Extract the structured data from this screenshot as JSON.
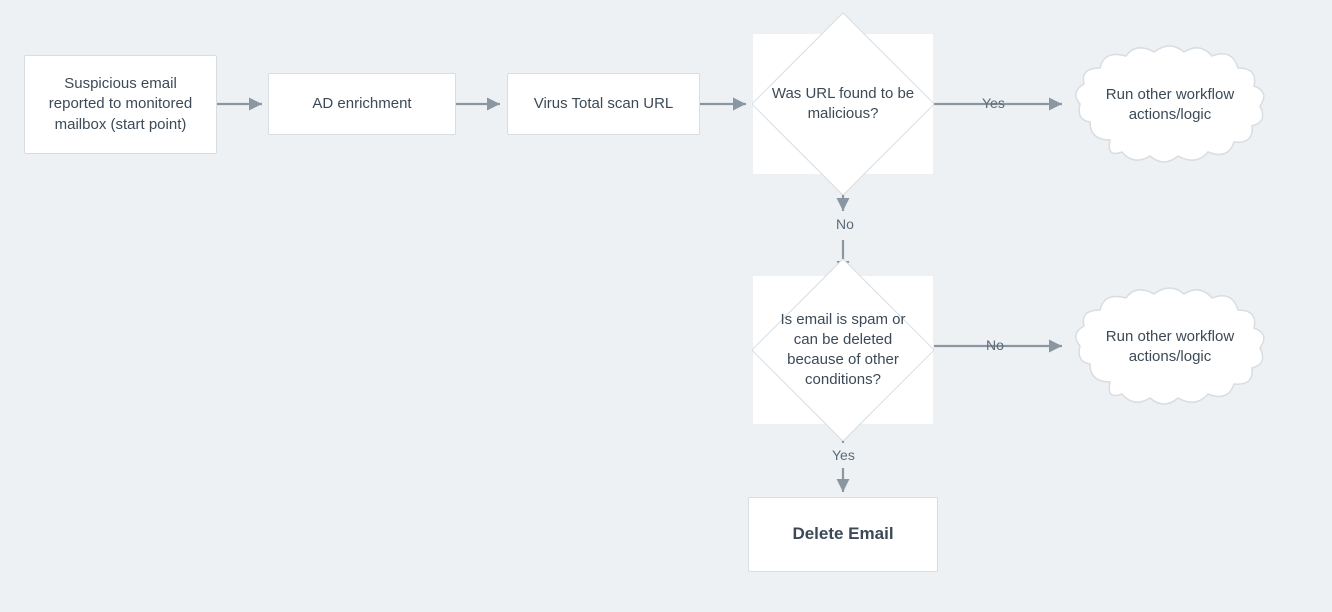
{
  "nodes": {
    "start": {
      "label": "Suspicious email reported to monitored mailbox (start point)"
    },
    "adEnrich": {
      "label": "AD enrichment"
    },
    "vtScan": {
      "label": "Virus Total scan URL"
    },
    "urlMalicious": {
      "label": "Was URL found to be malicious?"
    },
    "spamCheck": {
      "label": "Is email is spam or can be deleted because of other conditions?"
    },
    "deleteEmail": {
      "label": "Delete Email"
    },
    "cloud1": {
      "label": "Run other workflow actions/logic"
    },
    "cloud2": {
      "label": "Run other workflow actions/logic"
    }
  },
  "edgeLabels": {
    "yes1": "Yes",
    "no1": "No",
    "yes2": "Yes",
    "no2": "No"
  },
  "colors": {
    "bg": "#eef1f3",
    "stroke": "#8a97a3",
    "node": "#ffffff",
    "text": "#3c4a57"
  }
}
